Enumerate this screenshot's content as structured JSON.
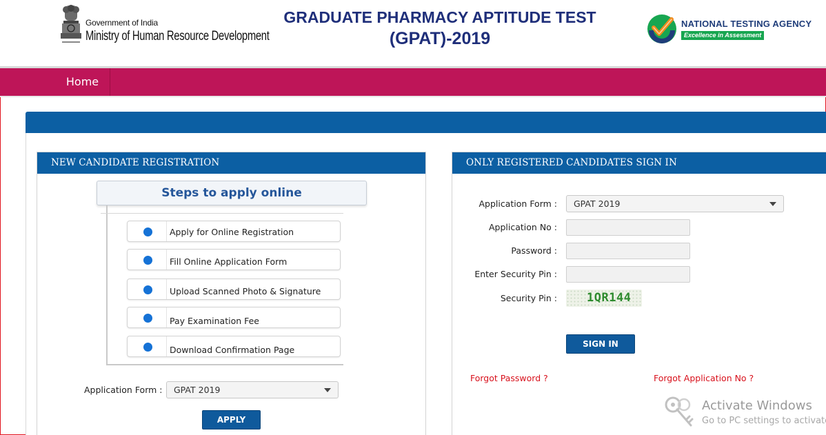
{
  "header": {
    "gov_line1": "Government of India",
    "gov_line2": "Ministry of Human Resource Development",
    "emblem_caption": "सत्यमेव जयते",
    "title_line1": "GRADUATE PHARMACY APTITUDE TEST",
    "title_line2": "(GPAT)-2019",
    "nta_name": "NATIONAL TESTING AGENCY",
    "nta_tagline": "Excellence in Assessment"
  },
  "nav": {
    "items": [
      {
        "label": "Home"
      }
    ]
  },
  "registration": {
    "heading": "NEW CANDIDATE REGISTRATION",
    "steps_title": "Steps to apply online",
    "steps": [
      {
        "label": "Apply for Online Registration"
      },
      {
        "label": "Fill Online Application Form"
      },
      {
        "label": "Upload Scanned Photo & Signature"
      },
      {
        "label": "Pay Examination Fee"
      },
      {
        "label": "Download Confirmation Page"
      }
    ],
    "application_form_label": "Application Form :",
    "application_form_value": "GPAT 2019",
    "apply_button": "APPLY"
  },
  "signin": {
    "heading": "ONLY REGISTERED CANDIDATES SIGN IN",
    "application_form_label": "Application Form :",
    "application_form_value": "GPAT 2019",
    "application_no_label": "Application No :",
    "application_no_value": "",
    "password_label": "Password :",
    "password_value": "",
    "security_pin_input_label": "Enter Security Pin :",
    "security_pin_input_value": "",
    "security_pin_label": "Security Pin :",
    "security_pin_value": "1QR144",
    "signin_button": "SIGN IN",
    "forgot_password": "Forgot Password ?",
    "forgot_application_no": "Forgot Application No ?"
  },
  "watermark": {
    "title": "Activate Windows",
    "subtitle": "Go to PC settings to activate Windows."
  },
  "colors": {
    "nav_bg": "#be1558",
    "panel_header": "#0c5fa3",
    "title": "#1f2f7a",
    "step_dot": "#1572d6",
    "link_red": "#d8111c",
    "nta_green": "#18a651",
    "captcha_green": "#2e8b2e"
  }
}
